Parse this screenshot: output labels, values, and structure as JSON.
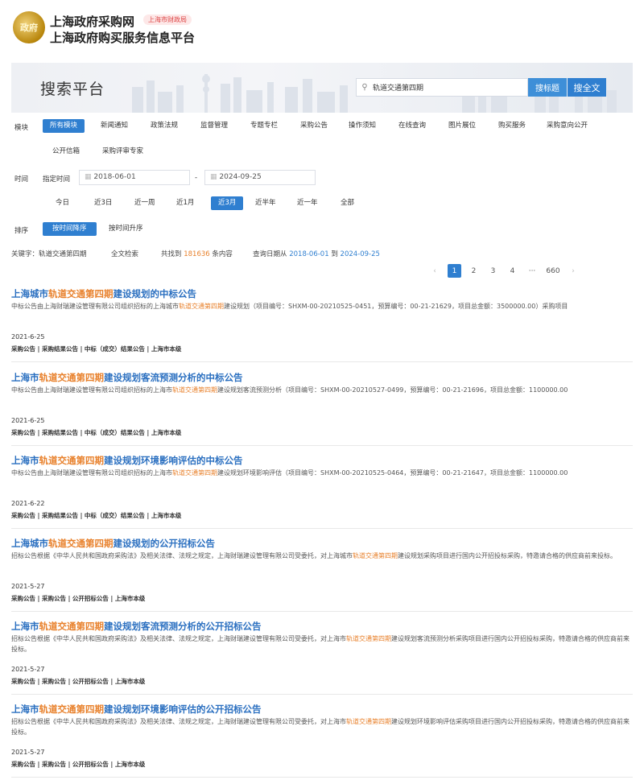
{
  "header": {
    "logo_text": "政府",
    "site_name": "上海政府采购网",
    "badge": "上海市财政局",
    "site_sub": "上海政府购买服务信息平台"
  },
  "banner": {
    "title": "搜索平台",
    "search_value": "轨道交通第四期",
    "btn_title": "搜标题",
    "btn_full": "搜全文"
  },
  "modules": {
    "label": "模块",
    "items": [
      "所有模块",
      "新闻通知",
      "政策法规",
      "监督管理",
      "专题专栏",
      "采购公告",
      "操作须知",
      "在线查询",
      "图片展位",
      "购买服务",
      "采购意向公开",
      "公开信箱",
      "采购评审专家"
    ]
  },
  "time": {
    "label": "时间",
    "specify_label": "指定时间",
    "start": "2018-06-01",
    "sep": "-",
    "end": "2024-09-25",
    "ranges": [
      "今日",
      "近3日",
      "近一周",
      "近1月",
      "近3月",
      "近半年",
      "近一年",
      "全部"
    ]
  },
  "sort": {
    "label": "排序",
    "options": [
      "按时间降序",
      "按时间升序"
    ]
  },
  "summary": {
    "keyword_label": "关键字：",
    "keyword": "轨道交通第四期",
    "scope": "全文检索",
    "found_prefix": "共找到",
    "count": "181636",
    "found_suffix": "条内容",
    "date_prefix": "查询日期从",
    "date_from": "2018-06-01",
    "date_mid": "到",
    "date_to": "2024-09-25"
  },
  "pager": {
    "prev": "‹",
    "pages": [
      "1",
      "2",
      "3",
      "4"
    ],
    "ellipsis": "···",
    "last": "660",
    "next": "›"
  },
  "results": [
    {
      "title_pre": "上海城市",
      "title_kw": "轨道交通第四期",
      "title_post": "建设规划的中标公告",
      "desc_pre": "中标公告由上海财瑞建设管理有限公司组织招标的上海城市",
      "desc_kw": "轨道交通第四期",
      "desc_post": "建设规划（项目编号：SHXM-00-20210525-0451，预算编号：00-21-21629，项目总金额：3500000.00）采购项目",
      "date": "2021-6-25",
      "tags": "采购公告 | 采购结果公告 | 中标（成交）结果公告 | 上海市本级"
    },
    {
      "title_pre": "上海市",
      "title_kw": "轨道交通第四期",
      "title_post": "建设规划客流预测分析的中标公告",
      "desc_pre": "中标公告由上海财瑞建设管理有限公司组织招标的上海市",
      "desc_kw": "轨道交通第四期",
      "desc_post": "建设规划客流预测分析（项目编号：SHXM-00-20210527-0499，预算编号：00-21-21696，项目总金额：1100000.00",
      "date": "2021-6-25",
      "tags": "采购公告 | 采购结果公告 | 中标（成交）结果公告 | 上海市本级"
    },
    {
      "title_pre": "上海市",
      "title_kw": "轨道交通第四期",
      "title_post": "建设规划环境影响评估的中标公告",
      "desc_pre": "中标公告由上海财瑞建设管理有限公司组织招标的上海市",
      "desc_kw": "轨道交通第四期",
      "desc_post": "建设规划环境影响评估（项目编号：SHXM-00-20210525-0464，预算编号：00-21-21647，项目总金额：1100000.00",
      "date": "2021-6-22",
      "tags": "采购公告 | 采购结果公告 | 中标（成交）结果公告 | 上海市本级"
    },
    {
      "title_pre": "上海城市",
      "title_kw": "轨道交通第四期",
      "title_post": "建设规划的公开招标公告",
      "desc_pre": "招标公告根据《中华人民共和国政府采购法》及相关法律、法规之规定，上海财瑞建设管理有限公司受委托，对上海城市",
      "desc_kw": "轨道交通第四期",
      "desc_post": "建设规划采购项目进行国内公开招投标采购，特邀请合格的供应商前来投标。",
      "date": "2021-5-27",
      "tags": "采购公告 | 采购公告 | 公开招标公告 | 上海市本级"
    },
    {
      "title_pre": "上海市",
      "title_kw": "轨道交通第四期",
      "title_post": "建设规划客流预测分析的公开招标公告",
      "desc_pre": "招标公告根据《中华人民共和国政府采购法》及相关法律、法规之规定，上海财瑞建设管理有限公司受委托，对上海市",
      "desc_kw": "轨道交通第四期",
      "desc_post": "建设规划客流预测分析采购项目进行国内公开招投标采购，特邀请合格的供应商前来投标。",
      "date": "2021-5-27",
      "tags": "采购公告 | 采购公告 | 公开招标公告 | 上海市本级"
    },
    {
      "title_pre": "上海市",
      "title_kw": "轨道交通第四期",
      "title_post": "建设规划环境影响评估的公开招标公告",
      "desc_pre": "招标公告根据《中华人民共和国政府采购法》及相关法律、法规之规定，上海财瑞建设管理有限公司受委托，对上海市",
      "desc_kw": "轨道交通第四期",
      "desc_post": "建设规划环境影响评估采购项目进行国内公开招投标采购，特邀请合格的供应商前来投标。",
      "date": "2021-5-27",
      "tags": "采购公告 | 采购公告 | 公开招标公告 | 上海市本级"
    }
  ],
  "colors": {
    "accent": "#2f7fd0",
    "keyword": "#e8812c",
    "title": "#2a6fc0"
  }
}
